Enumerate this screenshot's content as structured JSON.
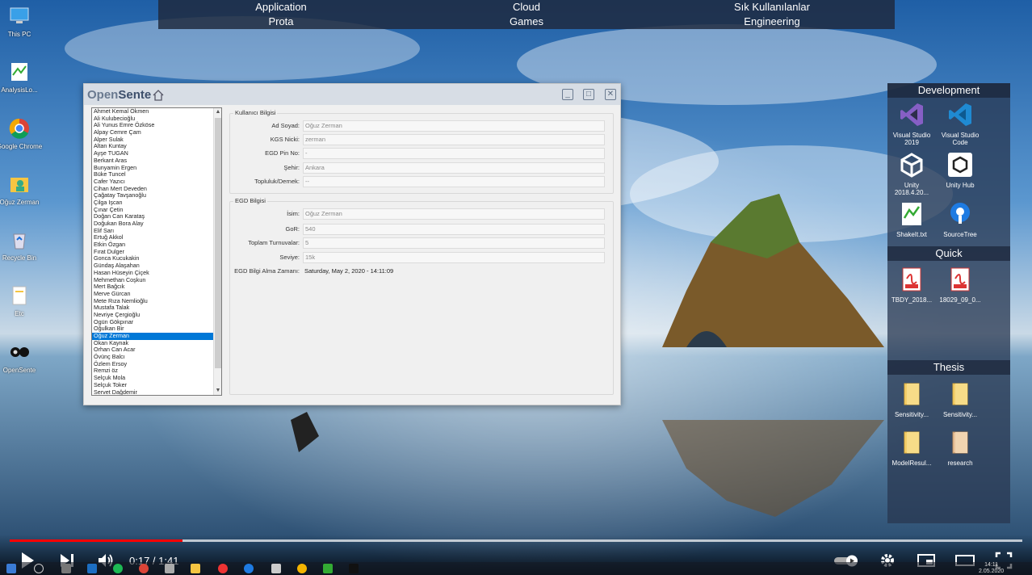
{
  "top_menu": {
    "row1": [
      "Application",
      "Cloud",
      "Sık Kullanılanlar"
    ],
    "row2": [
      "Prota",
      "Games",
      "Engineering"
    ]
  },
  "desktop_icons": [
    {
      "label": "This PC",
      "icon": "computer-icon"
    },
    {
      "label": "AnalysisLo...",
      "icon": "text-file-icon"
    },
    {
      "label": "Google Chrome",
      "icon": "chrome-icon"
    },
    {
      "label": "Oğuz Zerman",
      "icon": "user-folder-icon"
    },
    {
      "label": "Recycle Bin",
      "icon": "recycle-bin-icon"
    },
    {
      "label": "Etc",
      "icon": "file-icon"
    },
    {
      "label": "OpenSente",
      "icon": "opensente-icon"
    }
  ],
  "side_panel": {
    "sections": [
      {
        "title": "Development",
        "items": [
          {
            "label": "Visual Studio 2019",
            "icon": "visual-studio-icon"
          },
          {
            "label": "Visual Studio Code",
            "icon": "vscode-icon"
          },
          {
            "label": "Unity 2018.4.20...",
            "icon": "unity-icon"
          },
          {
            "label": "Unity Hub",
            "icon": "unity-hub-icon"
          },
          {
            "label": "ShakeIt.txt",
            "icon": "text-file-icon"
          },
          {
            "label": "SourceTree",
            "icon": "sourcetree-icon"
          }
        ]
      },
      {
        "title": "Quick",
        "items": [
          {
            "label": "TBDY_2018...",
            "icon": "pdf-icon"
          },
          {
            "label": "18029_09_0...",
            "icon": "pdf-icon"
          }
        ]
      },
      {
        "title": "Thesis",
        "items": [
          {
            "label": "Sensitivity...",
            "icon": "folder-icon"
          },
          {
            "label": "Sensitivity...",
            "icon": "folder-icon"
          },
          {
            "label": "ModelResul...",
            "icon": "folder-icon"
          },
          {
            "label": "research",
            "icon": "folder-icon"
          }
        ]
      }
    ]
  },
  "window": {
    "title_open": "Open",
    "title_sente": "Sente",
    "users": [
      "Ahmet Kemal Ökmen",
      "Ali Kulubecioğlu",
      "Ali Yunus Emre Özköse",
      "Alpay Cemre Çam",
      "Alper Sulak",
      "Altan Kuntay",
      "Ayşe TUGAN",
      "Berkant Aras",
      "Bunyamin Ergen",
      "Büke Tuncel",
      "Cafer Yazıcı",
      "Cihan Mert Deveden",
      "Çağatay Tavşanoğlu",
      "Çilga Işcan",
      "Çınar Çetin",
      "Doğan Can Karataş",
      "Doğukan Bora Alay",
      "Elif Sarı",
      "Ertuğ Akkol",
      "Etkin Özgan",
      "Fırat Dulger",
      "Gonca Kucukakin",
      "Gündaş Alaşahan",
      "Hasan Hüseyin Çiçek",
      "Mehmethan Coşkun",
      "Mert Bağcık",
      "Merve Gürcan",
      "Mete Rıza Nemlioğlu",
      "Mustafa Talak",
      "Nevriye Çergioğlu",
      "Ogün Gökpınar",
      "Oğulkan Bir",
      "Oğuz Zerman",
      "Okan Kaynak",
      "Orhan Can Acar",
      "Övünç Balcı",
      "Özlem Ersoy",
      "Remzi öz",
      "Selçuk Mola",
      "Selçuk Toker",
      "Servet Dağdemir"
    ],
    "selected_user": "Oğuz Zerman",
    "kullanici": {
      "title": "Kullanıcı Bilgisi",
      "fields": [
        {
          "label": "Ad Soyad:",
          "value": "Oğuz Zerman"
        },
        {
          "label": "KGS Nicki:",
          "value": "zerman"
        },
        {
          "label": "EGD Pin No:",
          "value": "-"
        },
        {
          "label": "Şehir:",
          "value": "Ankara"
        },
        {
          "label": "Topluluk/Dernek:",
          "value": "--"
        }
      ]
    },
    "egd": {
      "title": "EGD Bilgisi",
      "fields": [
        {
          "label": "İsim:",
          "value": "Oğuz Zerman"
        },
        {
          "label": "GoR:",
          "value": "540"
        },
        {
          "label": "Toplam Turnuvalar:",
          "value": "5"
        },
        {
          "label": "Seviye:",
          "value": "15k"
        }
      ],
      "time_label": "EGD Bilgi Alma Zamanı:",
      "time_value": "Saturday, May 2, 2020 - 14:11:09"
    }
  },
  "player": {
    "time": "0:17 / 1:41",
    "played_fraction": 0.17,
    "buffered_fraction": 1.0
  },
  "taskbar": {
    "clock_time": "14:11",
    "clock_date": "2.05.2020"
  },
  "colors": {
    "selection": "#0078d7",
    "progress": "#ff0000"
  }
}
